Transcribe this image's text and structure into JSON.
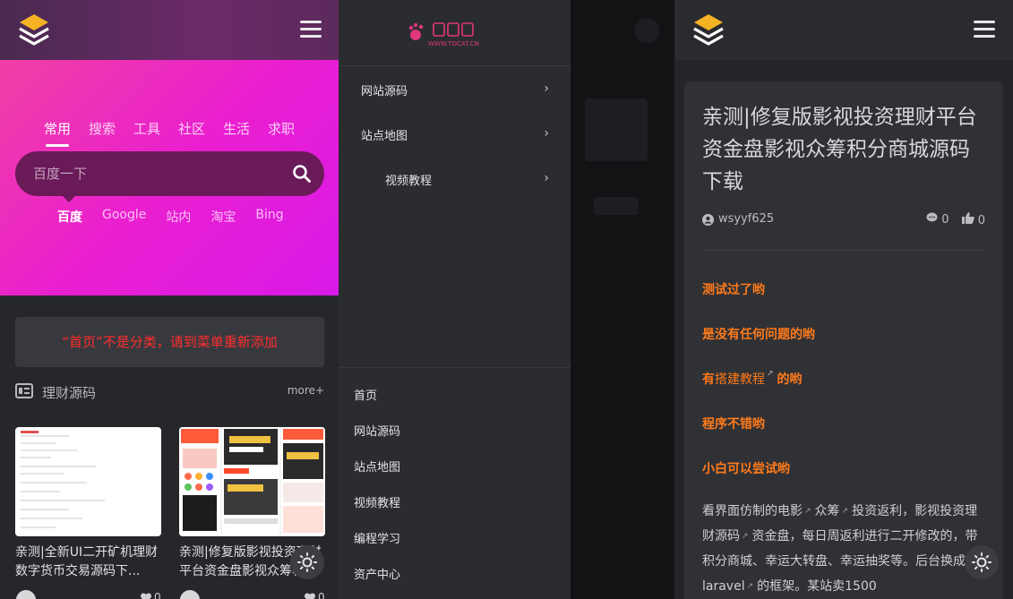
{
  "left": {
    "tabs": [
      "常用",
      "搜索",
      "工具",
      "社区",
      "生活",
      "求职"
    ],
    "search_placeholder": "百度一下",
    "engines": [
      "百度",
      "Google",
      "站内",
      "淘宝",
      "Bing"
    ],
    "notice": "“首页”不是分类，请到菜单重新添加",
    "section_title": "理财源码",
    "section_more": "more+",
    "cards": [
      {
        "title": "亲测|全新UI二开矿机理财数字货币交易源码下..."
      },
      {
        "title": "亲测|修复版影视投资理财平台资金盘影视众筹积..."
      }
    ],
    "card_counts": [
      "0",
      "0"
    ]
  },
  "middle": {
    "brand": "WWW.TOCAT.CN",
    "drawer_menu": [
      "网站源码",
      "站点地图",
      "视频教程"
    ],
    "drawer_links": [
      "首页",
      "网站源码",
      "站点地图",
      "视频教程",
      "编程学习",
      "资产中心"
    ]
  },
  "right": {
    "title": "亲测|修复版影视投资理财平台资金盘影视众筹积分商城源码下载",
    "author": "wsyyf625",
    "comments": "0",
    "likes": "0",
    "highlights": [
      "测试过了哟",
      "是没有任何问题的哟",
      "有",
      "搭建教程",
      "的哟",
      "程序不错哟",
      "小白可以尝试哟"
    ],
    "body": {
      "p1": "看界面仿制的电影",
      "link1": "众筹",
      "p2": "投资返利，影视投资理财源码",
      "p3": "资金盘，每日周返利进行二开修改的，带积分商城、幸运大转盘、幸运抽奖等。后台换成了",
      "link2": "laravel",
      "p4": "的框架。某站卖1500"
    }
  },
  "colors": {
    "hero_pink": "#ea1fd0",
    "notice_red": "#ff2d2d",
    "highlight_orange": "#ff7a1a",
    "logo_yellow": "#f5b324"
  }
}
